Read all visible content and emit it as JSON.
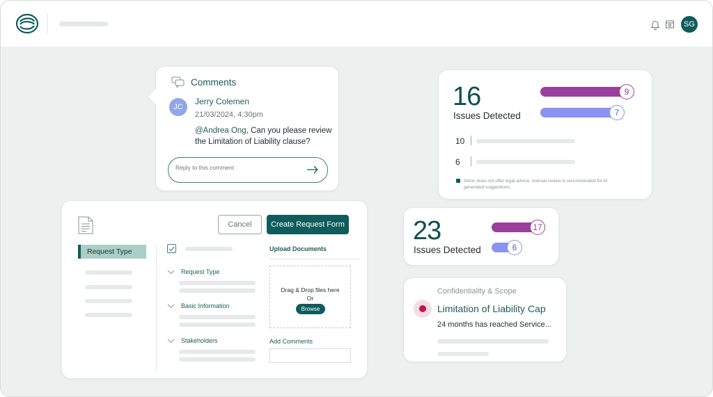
{
  "header": {
    "avatar_initials": "SG",
    "icons": [
      "app-logo-icon",
      "bell-icon",
      "inbox-icon"
    ]
  },
  "comments": {
    "title": "Comments",
    "author_initials": "JC",
    "author": "Jerry Colemen",
    "date": "21/03/2024, 4:30pm",
    "mention": "@Andrea Ong",
    "body": ", Can you please review the Limitation of Liability clause?",
    "reply_placeholder": "Reply to this comment"
  },
  "issues_card_1": {
    "count": "16",
    "label": "Issues Detected",
    "bar_values": [
      "9",
      "7"
    ],
    "rows": [
      "10",
      "6"
    ],
    "disclaimer": "Sirion does not offer legal advice, manual review is recommended for AI generated suggestions."
  },
  "issues_card_2": {
    "count": "23",
    "label": "Issues Detected",
    "bar_values": [
      "17",
      "6"
    ]
  },
  "clause_card": {
    "category": "Confidentiality & Scope",
    "title": "Limitation of Liability Cap",
    "description": "24 months has reached Service..."
  },
  "request_form": {
    "cancel_label": "Cancel",
    "create_label": "Create Request Form",
    "sidebar_active": "Request Type",
    "sections": [
      "Request Type",
      "Basic Information",
      "Stakeholders"
    ],
    "upload_title": "Upload Documents",
    "drop_text": "Drag & Drop files here",
    "or_text": "Or",
    "browse_label": "Browse",
    "add_comments_label": "Add Comments"
  },
  "colors": {
    "brand": "#0e5c5c",
    "purple": "#9a3f9e",
    "periwinkle": "#8a93f2",
    "alert": "#c8124a"
  }
}
